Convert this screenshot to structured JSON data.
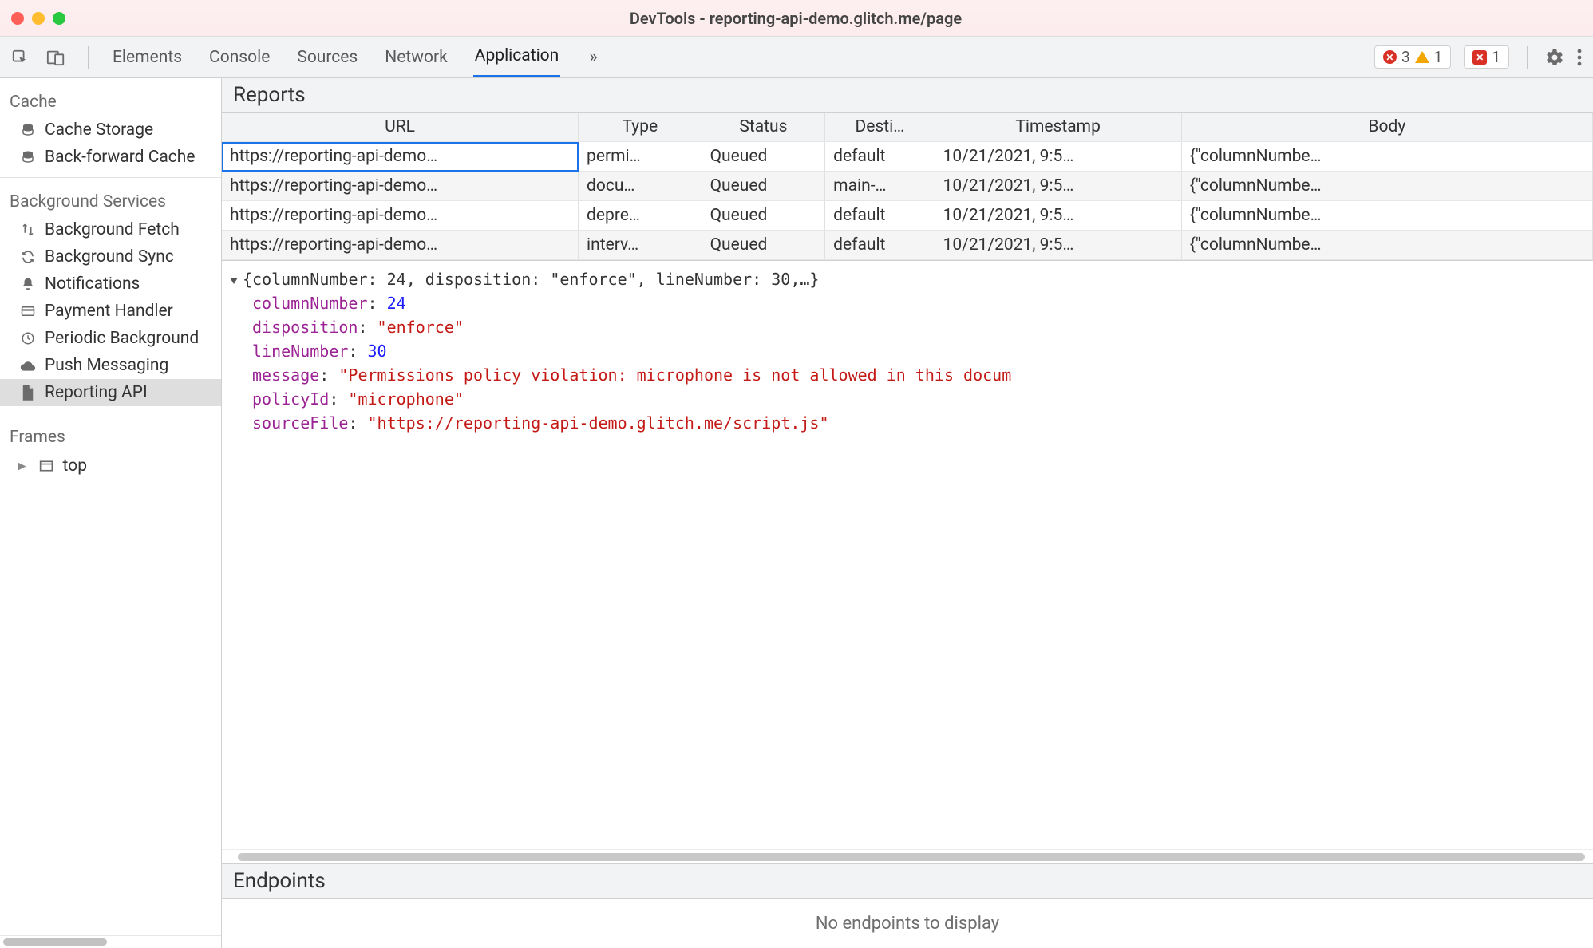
{
  "window": {
    "title": "DevTools - reporting-api-demo.glitch.me/page"
  },
  "toolbar": {
    "tabs": [
      "Elements",
      "Console",
      "Sources",
      "Network",
      "Application"
    ],
    "active_index": 4,
    "errors_badge": "3",
    "warnings_badge": "1",
    "issues_badge": "1"
  },
  "sidebar": {
    "sections": [
      {
        "heading": "Cache",
        "items": [
          {
            "label": "Cache Storage",
            "icon": "database-icon"
          },
          {
            "label": "Back-forward Cache",
            "icon": "database-icon"
          }
        ]
      },
      {
        "heading": "Background Services",
        "items": [
          {
            "label": "Background Fetch",
            "icon": "arrows-updown-icon"
          },
          {
            "label": "Background Sync",
            "icon": "sync-icon"
          },
          {
            "label": "Notifications",
            "icon": "bell-icon"
          },
          {
            "label": "Payment Handler",
            "icon": "card-icon"
          },
          {
            "label": "Periodic Background",
            "icon": "clock-icon"
          },
          {
            "label": "Push Messaging",
            "icon": "cloud-icon"
          },
          {
            "label": "Reporting API",
            "icon": "file-icon",
            "selected": true
          }
        ]
      },
      {
        "heading": "Frames",
        "items": [
          {
            "label": "top",
            "icon": "frame-icon",
            "expandable": true
          }
        ]
      }
    ]
  },
  "reports": {
    "heading": "Reports",
    "columns": [
      "URL",
      "Type",
      "Status",
      "Desti…",
      "Timestamp",
      "Body"
    ],
    "rows": [
      {
        "url": "https://reporting-api-demo…",
        "type": "permi…",
        "status": "Queued",
        "dest": "default",
        "ts": "10/21/2021, 9:5…",
        "body": "{\"columnNumbe…",
        "selected": true
      },
      {
        "url": "https://reporting-api-demo…",
        "type": "docu…",
        "status": "Queued",
        "dest": "main-…",
        "ts": "10/21/2021, 9:5…",
        "body": "{\"columnNumbe…"
      },
      {
        "url": "https://reporting-api-demo…",
        "type": "depre…",
        "status": "Queued",
        "dest": "default",
        "ts": "10/21/2021, 9:5…",
        "body": "{\"columnNumbe…"
      },
      {
        "url": "https://reporting-api-demo…",
        "type": "interv…",
        "status": "Queued",
        "dest": "default",
        "ts": "10/21/2021, 9:5…",
        "body": "{\"columnNumbe…"
      }
    ]
  },
  "detail": {
    "summary": "{columnNumber: 24, disposition: \"enforce\", lineNumber: 30,…}",
    "fields": {
      "columnNumber": "24",
      "disposition": "\"enforce\"",
      "lineNumber": "30",
      "message": "\"Permissions policy violation: microphone is not allowed in this docum",
      "policyId": "\"microphone\"",
      "sourceFile": "\"https://reporting-api-demo.glitch.me/script.js\""
    }
  },
  "endpoints": {
    "heading": "Endpoints",
    "empty_text": "No endpoints to display"
  }
}
